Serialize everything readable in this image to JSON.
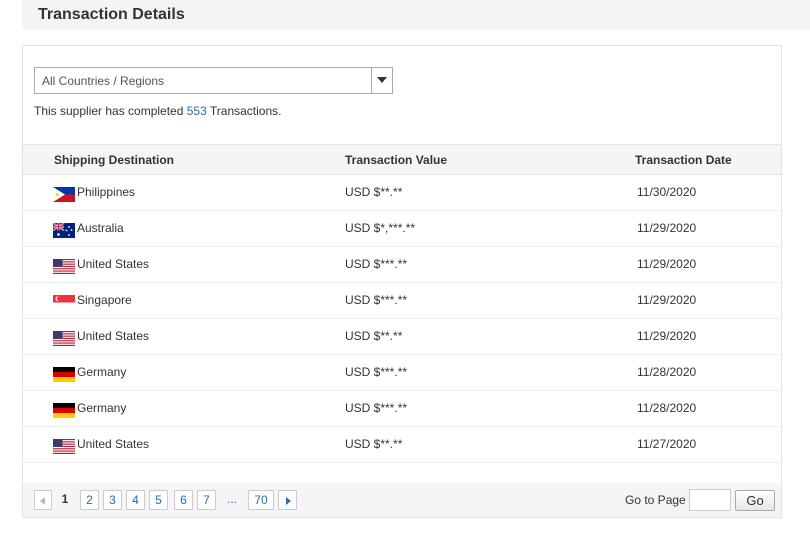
{
  "header": {
    "title": "Transaction Details"
  },
  "filter": {
    "selected": "All Countries / Regions"
  },
  "summary": {
    "prefix": "This supplier has completed ",
    "count": "553",
    "suffix": " Transactions."
  },
  "table": {
    "columns": [
      "Shipping Destination",
      "Transaction Value",
      "Transaction Date"
    ],
    "rows": [
      {
        "flag": "philippines-flag-icon",
        "country": "Philippines",
        "value": "USD $**.**",
        "date": "11/30/2020"
      },
      {
        "flag": "australia-flag-icon",
        "country": "Australia",
        "value": "USD $*,***.**",
        "date": "11/29/2020"
      },
      {
        "flag": "united-states-flag-icon",
        "country": "United States",
        "value": "USD $***.**",
        "date": "11/29/2020"
      },
      {
        "flag": "singapore-flag-icon",
        "country": "Singapore",
        "value": "USD $***.**",
        "date": "11/29/2020"
      },
      {
        "flag": "united-states-flag-icon",
        "country": "United States",
        "value": "USD $**.**",
        "date": "11/29/2020"
      },
      {
        "flag": "germany-flag-icon",
        "country": "Germany",
        "value": "USD $***.**",
        "date": "11/28/2020"
      },
      {
        "flag": "germany-flag-icon",
        "country": "Germany",
        "value": "USD $***.**",
        "date": "11/28/2020"
      },
      {
        "flag": "united-states-flag-icon",
        "country": "United States",
        "value": "USD $**.**",
        "date": "11/27/2020"
      }
    ]
  },
  "pagination": {
    "current": "1",
    "pages": [
      "2",
      "3",
      "4",
      "5",
      "6",
      "7"
    ],
    "ellipsis": "...",
    "last": "70",
    "prev_icon": "chevron-left-icon",
    "next_icon": "chevron-right-icon",
    "goto_label": "Go to Page",
    "goto_value": "",
    "go_label": "Go"
  },
  "colors": {
    "link": "#2b6cb0",
    "header_bg": "#f5f5f5",
    "border": "#e3e3e3"
  }
}
